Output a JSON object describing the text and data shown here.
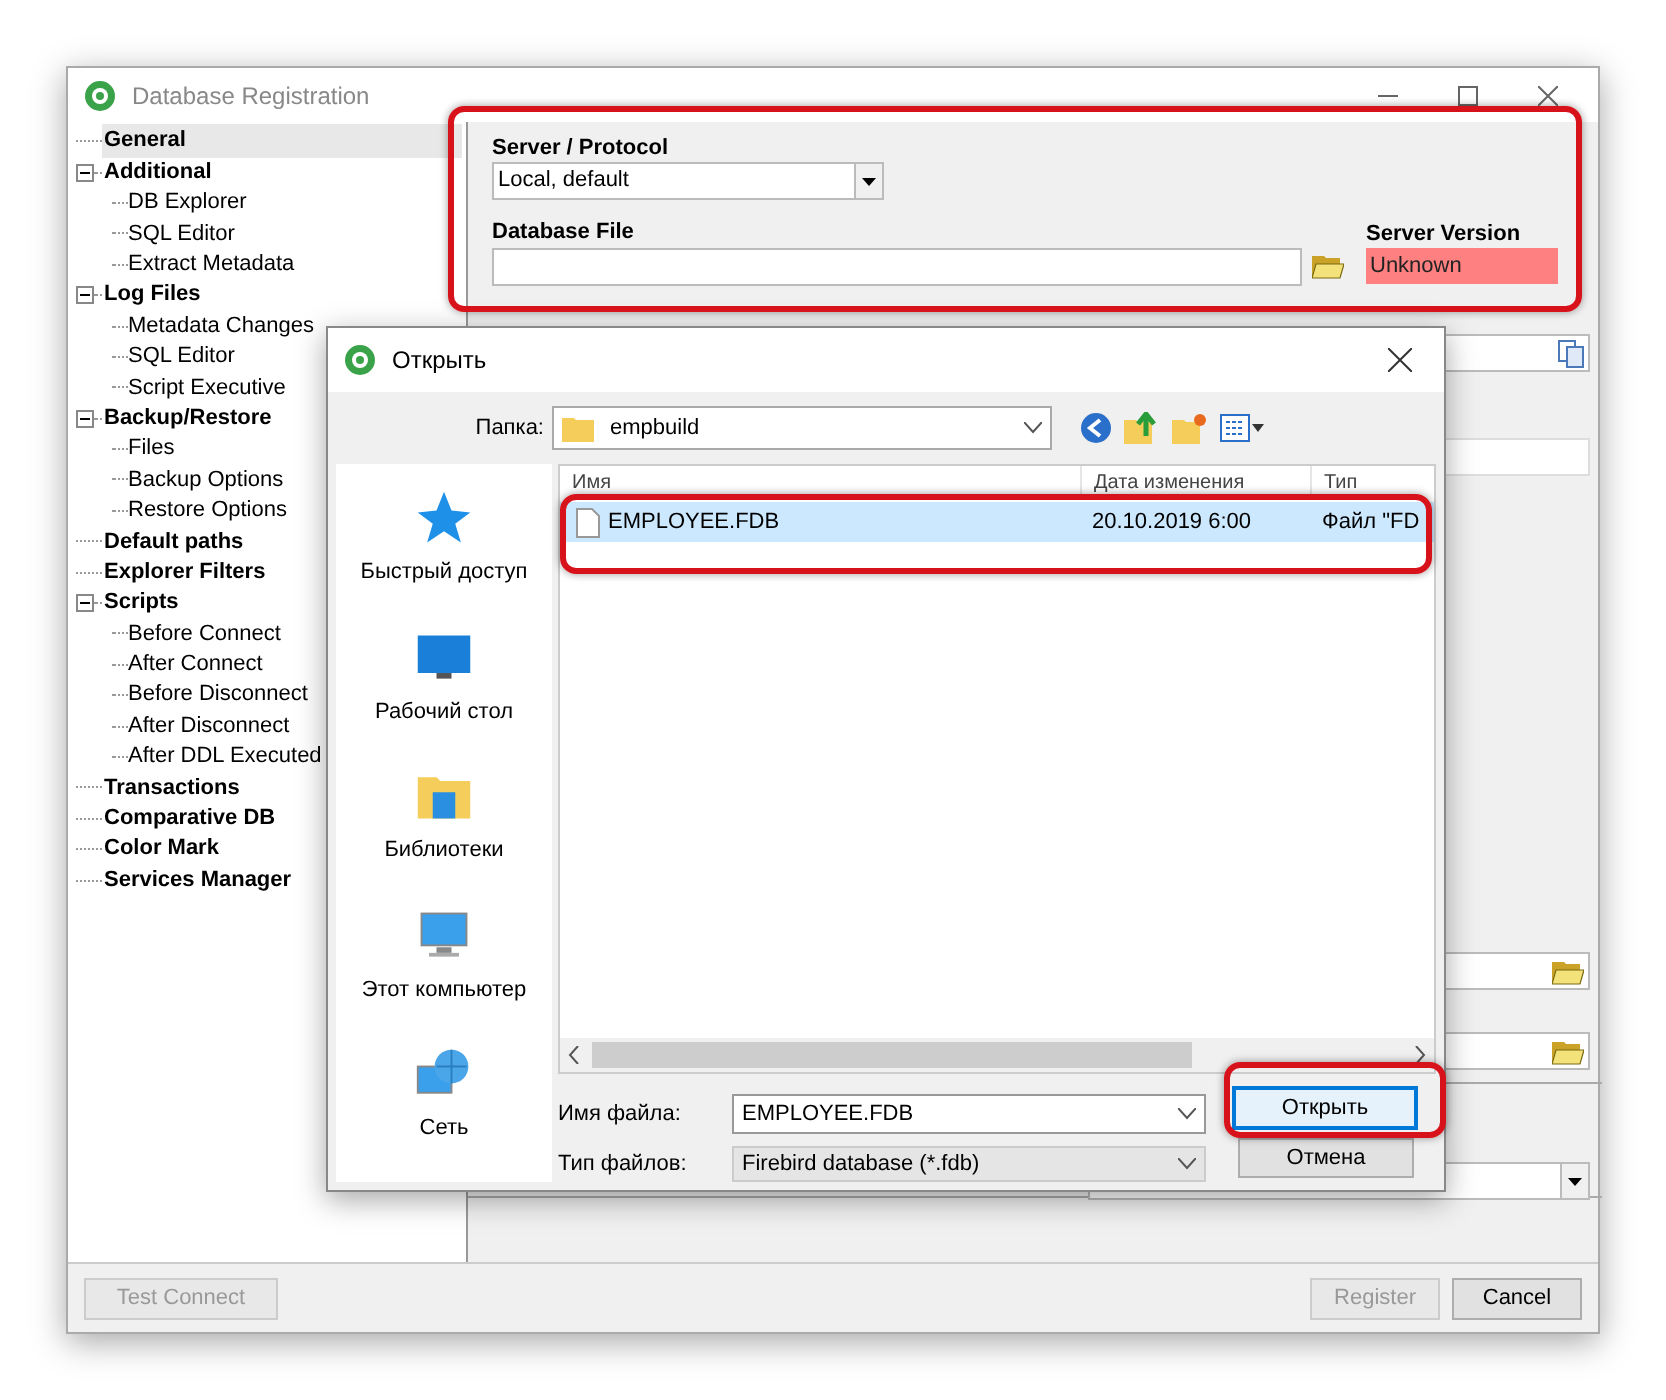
{
  "window": {
    "title": "Database Registration"
  },
  "tree": [
    {
      "label": "General",
      "selected": true
    },
    {
      "label": "Additional",
      "selected": false,
      "expanded": true,
      "children": [
        {
          "label": "DB Explorer",
          "selected": false
        },
        {
          "label": "SQL Editor",
          "selected": false
        },
        {
          "label": "Extract Metadata",
          "selected": false
        }
      ]
    },
    {
      "label": "Log Files",
      "selected": false,
      "expanded": true,
      "children": [
        {
          "label": "Metadata Changes",
          "selected": false
        },
        {
          "label": "SQL Editor",
          "selected": false
        },
        {
          "label": "Script Executive",
          "selected": false
        }
      ]
    },
    {
      "label": "Backup/Restore",
      "selected": false,
      "expanded": true,
      "children": [
        {
          "label": "Files",
          "selected": false
        },
        {
          "label": "Backup Options",
          "selected": false
        },
        {
          "label": "Restore Options",
          "selected": false
        }
      ]
    },
    {
      "label": "Default paths",
      "selected": false
    },
    {
      "label": "Explorer Filters",
      "selected": false
    },
    {
      "label": "Scripts",
      "selected": false,
      "expanded": true,
      "children": [
        {
          "label": "Before Connect",
          "selected": false
        },
        {
          "label": "After Connect",
          "selected": false
        },
        {
          "label": "Before Disconnect",
          "selected": false
        },
        {
          "label": "After Disconnect",
          "selected": false
        },
        {
          "label": "After DDL Executed",
          "selected": false
        }
      ]
    },
    {
      "label": "Transactions",
      "selected": false
    },
    {
      "label": "Comparative DB",
      "selected": false
    },
    {
      "label": "Color Mark",
      "selected": false
    },
    {
      "label": "Services Manager",
      "selected": false
    }
  ],
  "general": {
    "server_protocol_label": "Server / Protocol",
    "server_protocol": "Local, default",
    "database_file_label": "Database File",
    "server_version_label": "Server Version",
    "server_version": "Unknown"
  },
  "buttons": [
    {
      "label": "Test Connect",
      "disabled": true
    },
    {
      "label": "Register",
      "disabled": true
    },
    {
      "label": "Cancel",
      "disabled": false
    }
  ],
  "dialog": {
    "title": "Открыть",
    "folder_label": "Папка:",
    "folder": "empbuild",
    "places": [
      {
        "label": "Быстрый доступ",
        "kind": "star"
      },
      {
        "label": "Рабочий стол",
        "kind": "desktop"
      },
      {
        "label": "Библиотеки",
        "kind": "library"
      },
      {
        "label": "Этот компьютер",
        "kind": "computer"
      },
      {
        "label": "Сеть",
        "kind": "network"
      }
    ],
    "columns": [
      "Имя",
      "Дата изменения",
      "Тип"
    ],
    "files": [
      {
        "name": "EMPLOYEE.FDB",
        "date": "20.10.2019 6:00",
        "type": "Файл \"FD",
        "selected": true
      }
    ],
    "filename_label": "Имя файла:",
    "filename": "EMPLOYEE.FDB",
    "filetype_label": "Тип файлов:",
    "filetype": "Firebird database (*.fdb)",
    "open_button": "Открыть",
    "cancel_button": "Отмена"
  }
}
